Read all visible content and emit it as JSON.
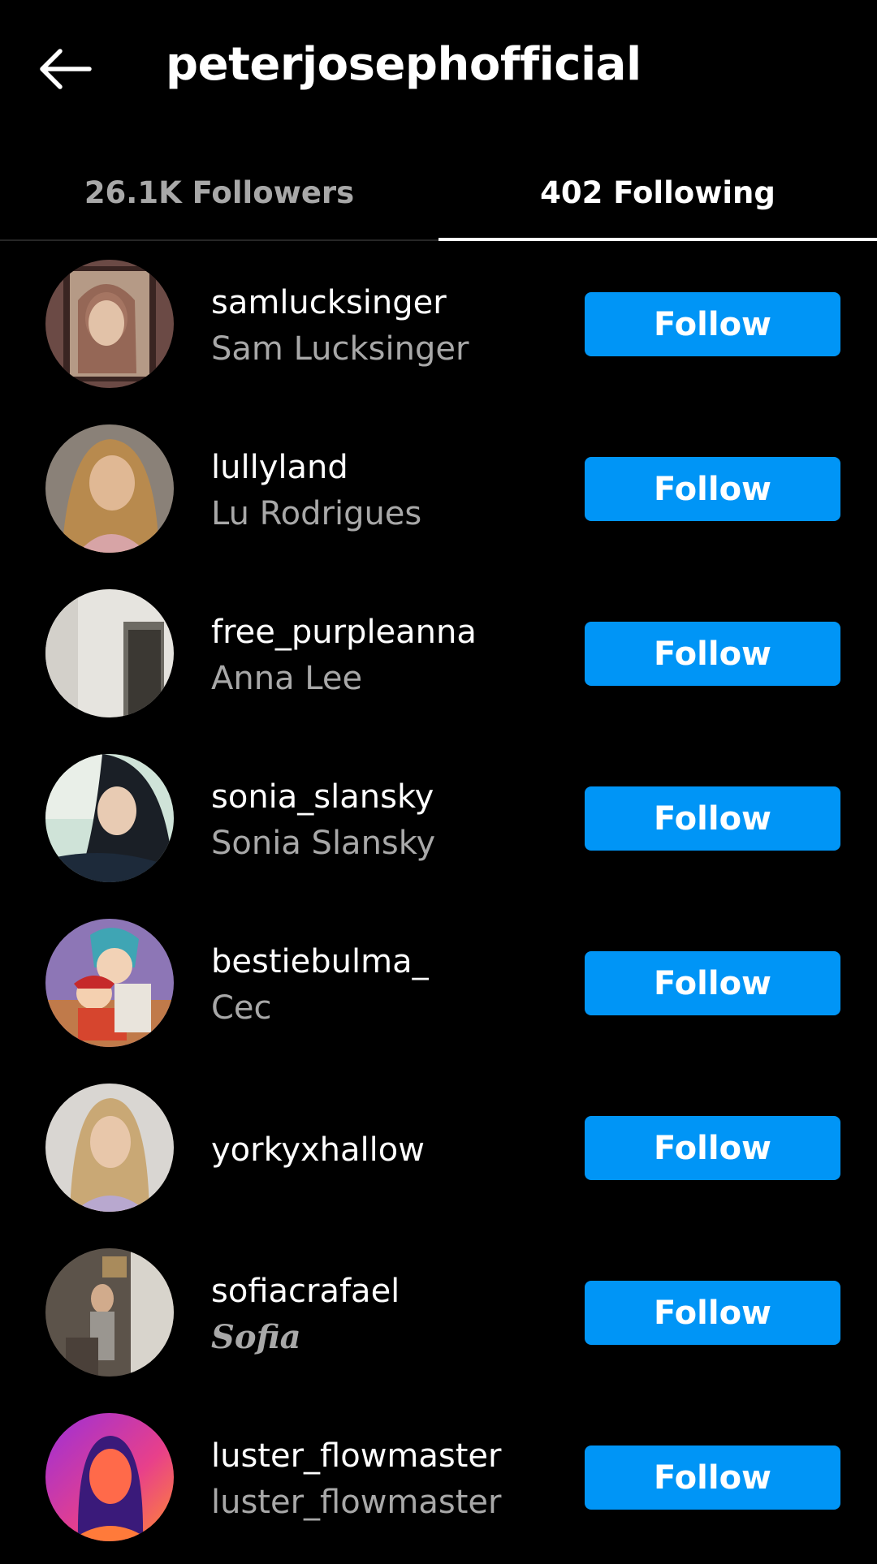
{
  "header": {
    "title": "peterjosephofficial",
    "back_icon": "arrow-left-icon"
  },
  "tabs": [
    {
      "label": "26.1K Followers",
      "active": false
    },
    {
      "label": "402 Following",
      "active": true
    }
  ],
  "colors": {
    "background": "#000000",
    "follow_button": "#0095f6",
    "secondary_text": "#a8a8a8"
  },
  "users": [
    {
      "username": "samlucksinger",
      "full_name": "Sam Lucksinger",
      "button": "Follow"
    },
    {
      "username": "lullyland",
      "full_name": "Lu Rodrigues",
      "button": "Follow"
    },
    {
      "username": "free_purpleanna",
      "full_name": "Anna Lee",
      "button": "Follow"
    },
    {
      "username": "sonia_slansky",
      "full_name": "Sonia Slansky",
      "button": "Follow"
    },
    {
      "username": "bestiebulma_",
      "full_name": "Cec",
      "button": "Follow"
    },
    {
      "username": "yorkyxhallow",
      "full_name": "",
      "button": "Follow"
    },
    {
      "username": "sofiacrafael",
      "full_name": "Sofia",
      "button": "Follow"
    },
    {
      "username": "luster_flowmaster",
      "full_name": "luster_flowmaster",
      "button": "Follow"
    }
  ]
}
